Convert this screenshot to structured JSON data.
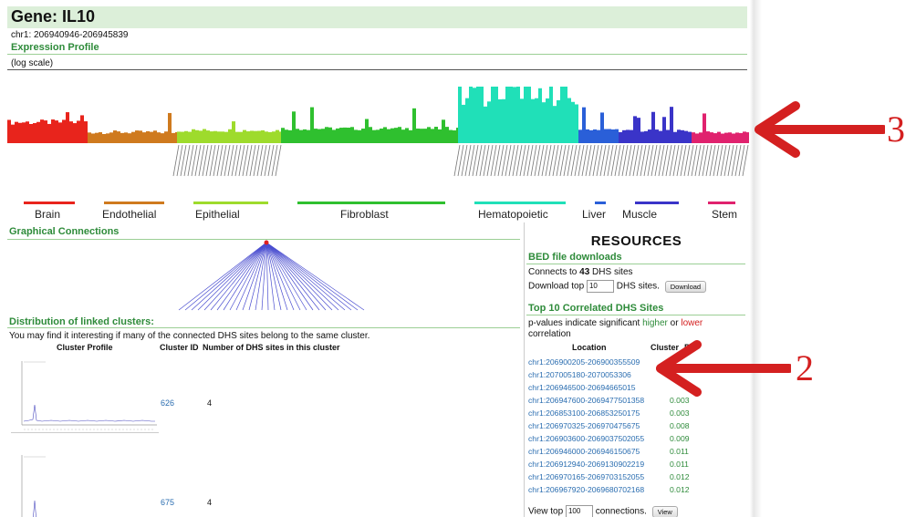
{
  "gene": {
    "title": "Gene: IL10",
    "coords": "chr1: 206940946-206945839"
  },
  "expression": {
    "title": "Expression Profile",
    "scale_note": "(log scale)"
  },
  "tissues": [
    "Brain",
    "Endothelial",
    "Epithelial",
    "Fibroblast",
    "Hematopoietic",
    "Liver",
    "Muscle",
    "Stem"
  ],
  "tissue_colors": [
    "#e8241c",
    "#cf7a1e",
    "#9edb2c",
    "#2fc02f",
    "#20e0b8",
    "#2a5fd8",
    "#3a34c8",
    "#e0226e"
  ],
  "graph": {
    "title": "Graphical Connections"
  },
  "distribution": {
    "title": "Distribution of linked clusters:",
    "desc": "You may find it interesting if many of the connected DHS sites belong to the same cluster.",
    "col_profile": "Cluster Profile",
    "col_id": "Cluster ID",
    "col_count": "Number of DHS sites in this cluster",
    "rows": [
      {
        "id": "626",
        "count": "4"
      },
      {
        "id": "675",
        "count": "4"
      }
    ]
  },
  "resources": {
    "heading": "RESOURCES",
    "bed_title": "BED file downloads",
    "connects_pre": "Connects to ",
    "connects_num": "43",
    "connects_post": " DHS sites",
    "dl_pre": "Download top",
    "dl_value": "10",
    "dl_post": "DHS sites.",
    "dl_button": "Download",
    "top_title": "Top 10 Correlated DHS Sites",
    "pval_pre": "p-values indicate significant ",
    "pval_higher": "higher",
    "pval_or": " or ",
    "pval_lower": "lower",
    "pval_post": " correlation",
    "col_location": "Location",
    "col_cluster": "Cluster",
    "col_p": "P",
    "rows": [
      {
        "loc": "chr1:206900205-206900355",
        "cluster": "509",
        "p": ""
      },
      {
        "loc": "chr1:207005180-207005330",
        "cluster": "6",
        "p": ""
      },
      {
        "loc": "chr1:206946500-206946650",
        "cluster": "15",
        "p": ""
      },
      {
        "loc": "chr1:206947600-206947750",
        "cluster": "1358",
        "p": "0.003"
      },
      {
        "loc": "chr1:206853100-206853250",
        "cluster": "175",
        "p": "0.003"
      },
      {
        "loc": "chr1:206970325-206970475",
        "cluster": "675",
        "p": "0.008"
      },
      {
        "loc": "chr1:206903600-206903750",
        "cluster": "2055",
        "p": "0.009"
      },
      {
        "loc": "chr1:206946000-206946150",
        "cluster": "675",
        "p": "0.011"
      },
      {
        "loc": "chr1:206912940-206913090",
        "cluster": "2219",
        "p": "0.011"
      },
      {
        "loc": "chr1:206970165-206970315",
        "cluster": "2055",
        "p": "0.012"
      },
      {
        "loc": "chr1:206967920-206968070",
        "cluster": "2168",
        "p": "0.012"
      }
    ],
    "view_pre": "View top",
    "view_value": "100",
    "view_post": "connections.",
    "view_button": "View"
  },
  "annotations": [
    {
      "label": "3",
      "color": "#d42020"
    },
    {
      "label": "2",
      "color": "#d42020"
    }
  ]
}
